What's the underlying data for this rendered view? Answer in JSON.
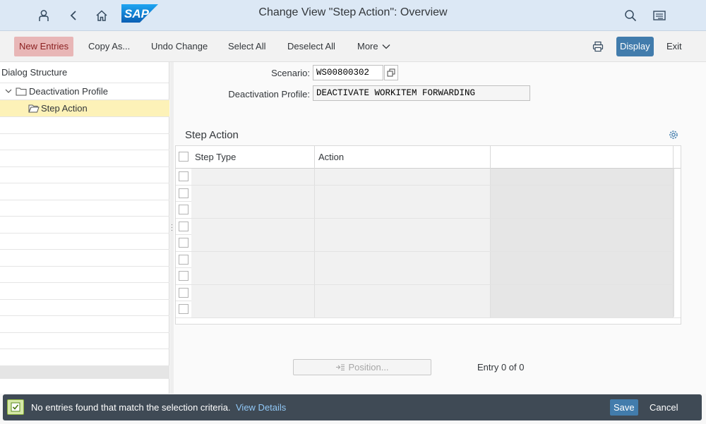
{
  "shell": {
    "title": "Change View \"Step Action\": Overview",
    "logo_text": "SAP",
    "brand_color": "#0a6ed1"
  },
  "toolbar": {
    "new_entries": "New Entries",
    "copy_as": "Copy As...",
    "undo_change": "Undo Change",
    "select_all": "Select All",
    "deselect_all": "Deselect All",
    "more": "More",
    "display": "Display",
    "exit": "Exit"
  },
  "dialog": {
    "title": "Dialog Structure",
    "items": [
      {
        "label": "Deactivation Profile"
      },
      {
        "label": "Step Action"
      }
    ]
  },
  "form": {
    "scenario_label": "Scenario:",
    "scenario_value": "WS00800302",
    "profile_label": "Deactivation Profile:",
    "profile_value": "DEACTIVATE WORKITEM FORWARDING"
  },
  "table": {
    "title": "Step Action",
    "columns": [
      "Step Type",
      "Action"
    ]
  },
  "footer": {
    "position": "Position...",
    "entry": "Entry 0 of 0"
  },
  "message": {
    "text": "No entries found that match the selection criteria.",
    "link": "View Details",
    "save": "Save",
    "cancel": "Cancel"
  }
}
